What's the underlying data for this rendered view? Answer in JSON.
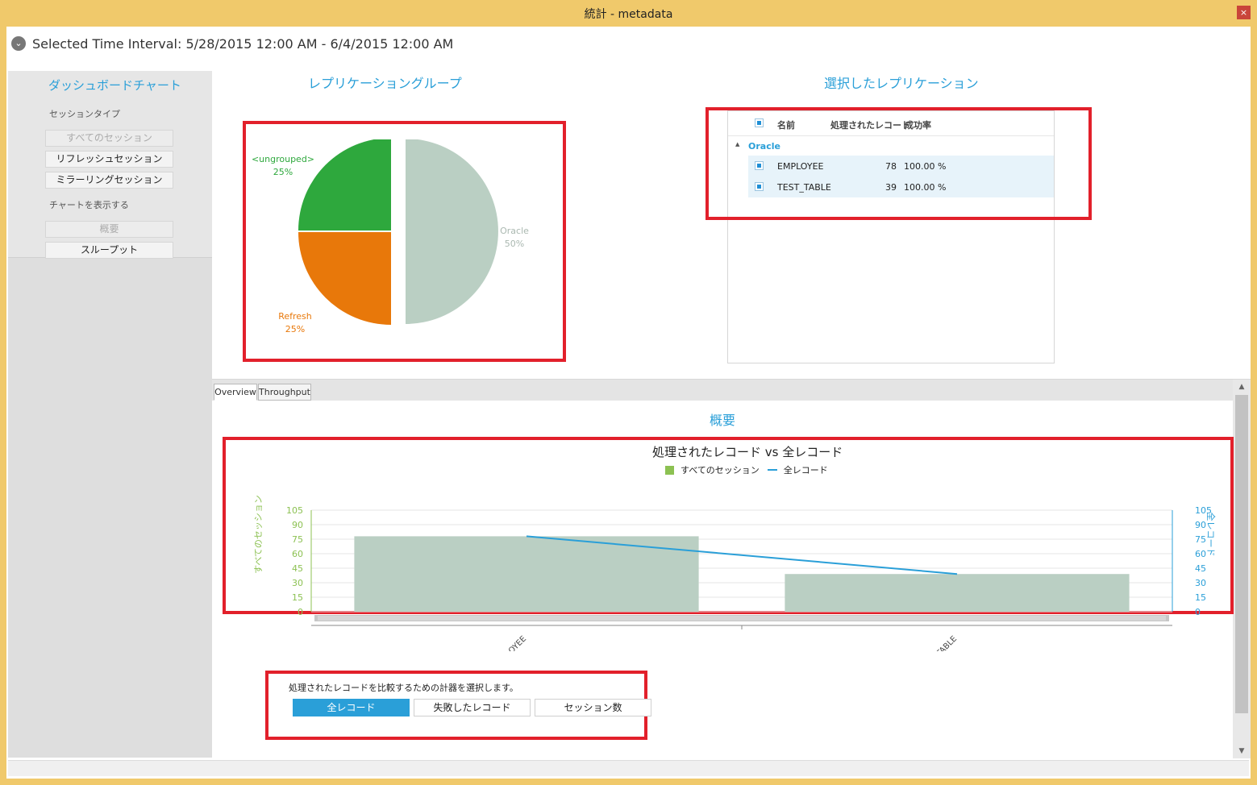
{
  "window": {
    "title": "統計 - metadata",
    "close_label": "×"
  },
  "interval": {
    "text": "Selected Time Interval: 5/28/2015 12:00 AM - 6/4/2015 12:00 AM",
    "toggle": "⌄"
  },
  "sidebar": {
    "heading": "ダッシュボードチャート",
    "session_type_label": "セッションタイプ",
    "session_buttons": [
      "すべてのセッション",
      "リフレッシュセッション",
      "ミラーリングセッション"
    ],
    "show_chart_label": "チャートを表示する",
    "chart_buttons": [
      "概要",
      "スループット"
    ]
  },
  "replication_group": {
    "title": "レプリケーショングループ",
    "slices": [
      {
        "name": "<ungrouped>",
        "pct": "25%",
        "value": 25,
        "color": "#2ea83d"
      },
      {
        "name": "Refresh",
        "pct": "25%",
        "value": 25,
        "color": "#e8780a"
      },
      {
        "name": "Oracle",
        "pct": "50%",
        "value": 50,
        "color": "#bacfc3"
      }
    ]
  },
  "selected_replication": {
    "title": "選択したレプリケーション",
    "columns": [
      "名前",
      "処理されたレコード",
      "成功率"
    ],
    "group": "Oracle",
    "group_toggle": "▲",
    "rows": [
      {
        "name": "EMPLOYEE",
        "records": "78",
        "rate": "100.00 %"
      },
      {
        "name": "TEST_TABLE",
        "records": "39",
        "rate": "100.00 %"
      }
    ]
  },
  "tabs": [
    "Overview",
    "Throughput"
  ],
  "overview": {
    "title": "概要"
  },
  "chart_data": {
    "type": "bar",
    "title": "処理されたレコード vs 全レコード",
    "categories": [
      "EMPLOYEE",
      "TEST_TABLE"
    ],
    "series": [
      {
        "name": "すべてのセッション",
        "type": "bar",
        "values": [
          78,
          39
        ],
        "color": "#8cc152"
      },
      {
        "name": "全レコード",
        "type": "line",
        "values": [
          78,
          39
        ],
        "color": "#2a9fd8"
      }
    ],
    "bar_fill": "#bacfc3",
    "ylabel_left": "すべてのセッション",
    "ylabel_right": "全レコード",
    "ylim": [
      0,
      105
    ],
    "yticks": [
      "105",
      "90",
      "75",
      "60",
      "45",
      "30",
      "15",
      "0"
    ],
    "grid": true,
    "legend_position": "top"
  },
  "compare": {
    "label": "処理されたレコードを比較するための計器を選択します。",
    "buttons": [
      "全レコード",
      "失敗したレコード",
      "セッション数"
    ]
  }
}
